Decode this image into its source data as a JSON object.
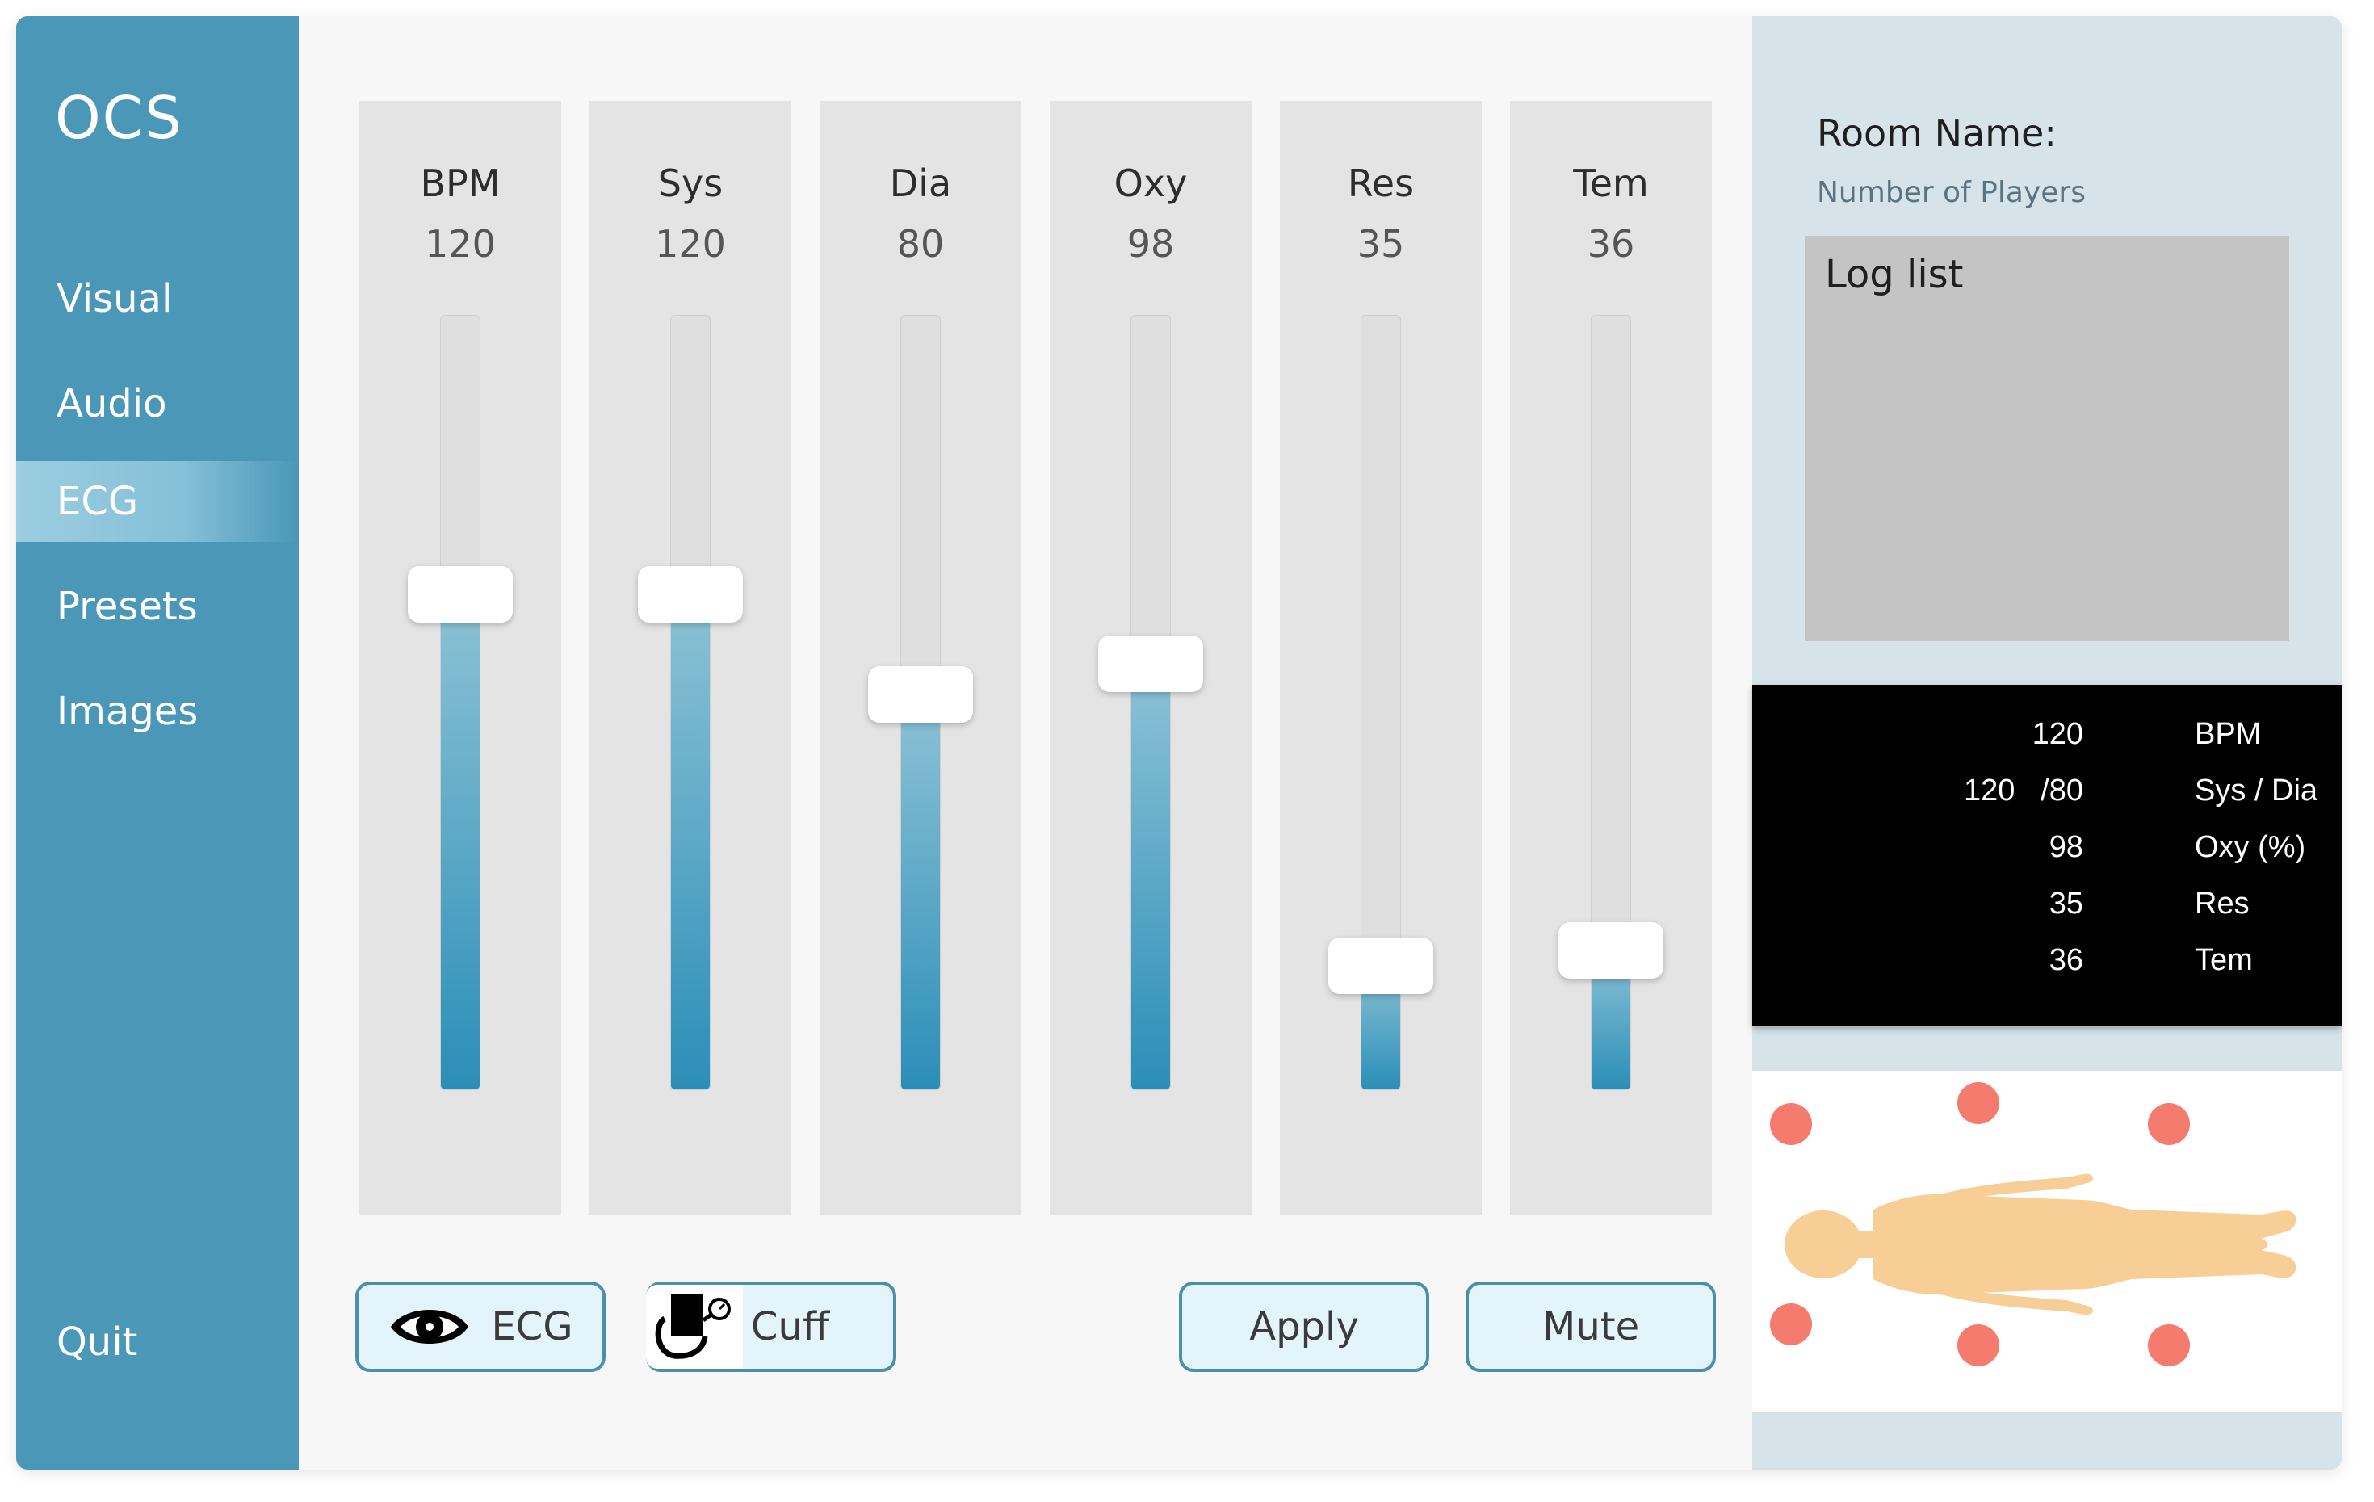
{
  "app": {
    "title": "OCS"
  },
  "sidebar": {
    "items": [
      {
        "label": "Visual",
        "active": false
      },
      {
        "label": "Audio",
        "active": false
      },
      {
        "label": "ECG",
        "active": true
      },
      {
        "label": "Presets",
        "active": false
      },
      {
        "label": "Images",
        "active": false
      }
    ],
    "quit_label": "Quit"
  },
  "sliders": [
    {
      "name": "BPM",
      "value": "120",
      "level": 0.64
    },
    {
      "name": "Sys",
      "value": "120",
      "level": 0.64
    },
    {
      "name": "Dia",
      "value": "80",
      "level": 0.51
    },
    {
      "name": "Oxy",
      "value": "98",
      "level": 0.55
    },
    {
      "name": "Res",
      "value": "35",
      "level": 0.16
    },
    {
      "name": "Tem",
      "value": "36",
      "level": 0.18
    }
  ],
  "buttons": {
    "ecg_label": "ECG",
    "cuff_label": "Cuff",
    "apply_label": "Apply",
    "mute_label": "Mute"
  },
  "room": {
    "name_label": "Room Name:",
    "players_label": "Number of Players",
    "log_title": "Log list"
  },
  "monitor": {
    "bpm": {
      "value": "120",
      "label": "BPM"
    },
    "bp": {
      "sys": "120",
      "dia": "/80",
      "label": "Sys / Dia"
    },
    "oxy": {
      "value": "98",
      "label": "Oxy (%)"
    },
    "res": {
      "value": "35",
      "label": "Res"
    },
    "tem": {
      "value": "36",
      "label": "Tem"
    }
  },
  "colors": {
    "sidebar": "#4a97b8",
    "slider_fill": "#2b8eb8",
    "button_border": "#4a90ad",
    "sensor": "#f47b6d",
    "body": "#f7cf96"
  },
  "icons": {
    "ecg_button": "eye-icon",
    "cuff_button": "blood-pressure-cuff-icon",
    "figure": "human-body-figure"
  }
}
